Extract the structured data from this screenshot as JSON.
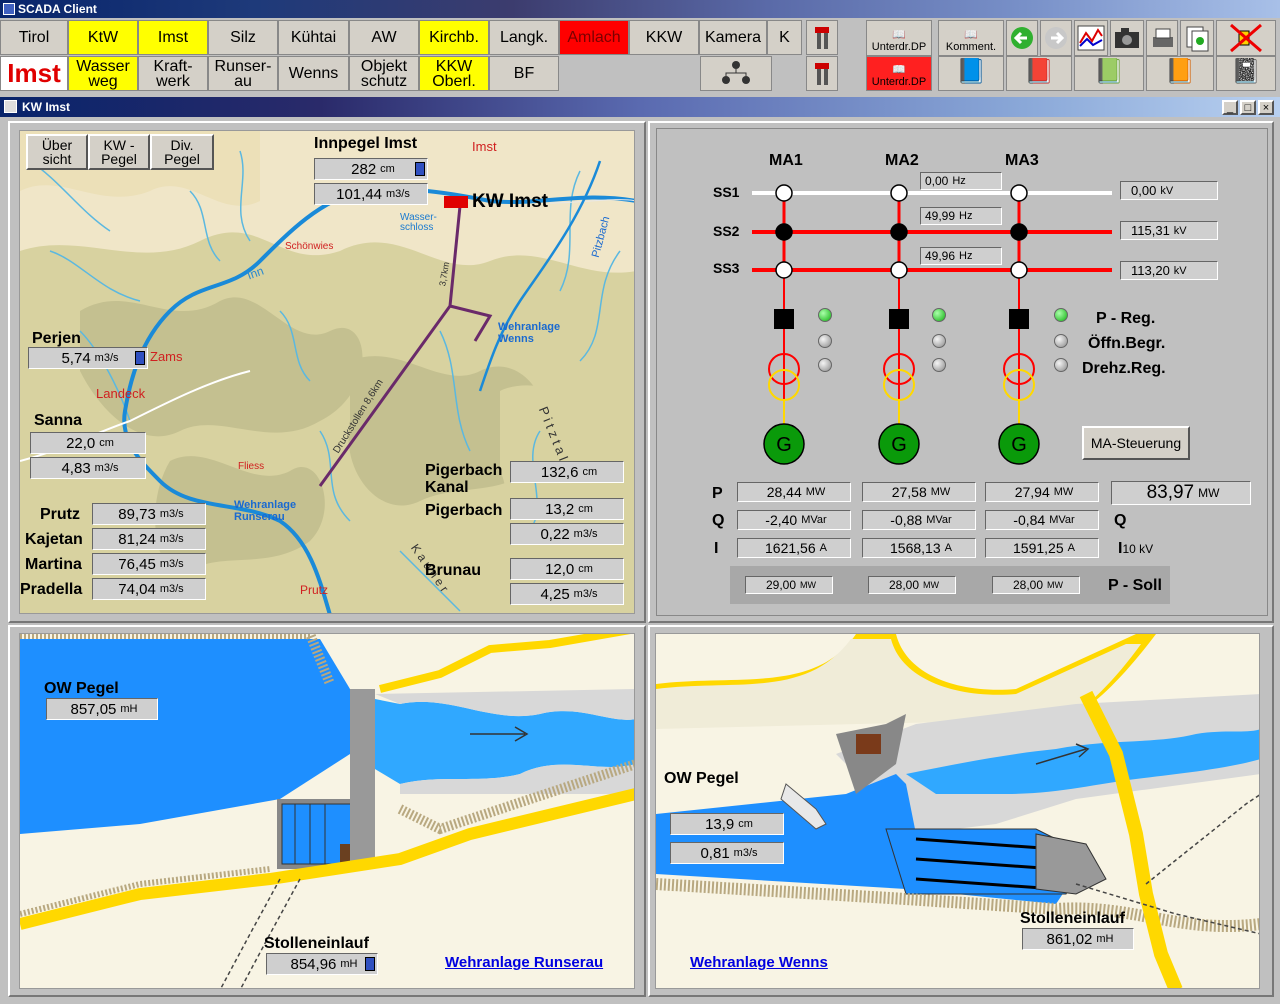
{
  "window_title": "SCADA Client",
  "nav_row1": [
    {
      "label": "Tirol",
      "style": "n"
    },
    {
      "label": "KtW",
      "style": "y"
    },
    {
      "label": "Imst",
      "style": "y"
    },
    {
      "label": "Silz",
      "style": "n"
    },
    {
      "label": "Kühtai",
      "style": "n"
    },
    {
      "label": "AW",
      "style": "n"
    },
    {
      "label": "Kirchb.",
      "style": "y"
    },
    {
      "label": "Langk.",
      "style": "n"
    },
    {
      "label": "Amlach",
      "style": "r"
    },
    {
      "label": "KKW",
      "style": "n"
    },
    {
      "label": "Kamera",
      "style": "n"
    },
    {
      "label": "K",
      "style": "n"
    }
  ],
  "nav_row2": [
    {
      "label": "Imst",
      "style": "big"
    },
    {
      "label": "Wasser weg",
      "style": "y"
    },
    {
      "label": "Kraft- werk",
      "style": "n"
    },
    {
      "label": "Runser- au",
      "style": "n"
    },
    {
      "label": "Wenns",
      "style": "n"
    },
    {
      "label": "Objekt schutz",
      "style": "n"
    },
    {
      "label": "KKW Oberl.",
      "style": "y"
    },
    {
      "label": "BF",
      "style": "n"
    }
  ],
  "toolbar": {
    "unterdr_label": "Unterdr.DP",
    "komment_label": "Komment.",
    "unterdr2_label": "Unterdr.DP"
  },
  "subwindow": {
    "title": "KW Imst",
    "controls": [
      "_",
      "□",
      "×"
    ]
  },
  "map": {
    "tabs": [
      "Über sicht",
      "KW - Pegel",
      "Div. Pegel"
    ],
    "kw_label": "KW Imst",
    "inn_pegel": {
      "label": "Innpegel Imst",
      "level": "282",
      "level_unit": "cm",
      "flow": "101,44",
      "flow_unit": "m3/s"
    },
    "perjen": {
      "label": "Perjen",
      "flow": "5,74",
      "flow_unit": "m3/s"
    },
    "sanna": {
      "label": "Sanna",
      "level": "22,0",
      "level_unit": "cm",
      "flow": "4,83",
      "flow_unit": "m3/s"
    },
    "gauges": [
      {
        "label": "Prutz",
        "value": "89,73",
        "unit": "m3/s"
      },
      {
        "label": "Kajetan",
        "value": "81,24",
        "unit": "m3/s"
      },
      {
        "label": "Martina",
        "value": "76,45",
        "unit": "m3/s"
      },
      {
        "label": "Pradella",
        "value": "74,04",
        "unit": "m3/s"
      }
    ],
    "pigerbach_kanal": {
      "label": "Pigerbach Kanal",
      "value": "132,6",
      "unit": "cm"
    },
    "pigerbach": {
      "label": "Pigerbach",
      "level": "13,2",
      "level_unit": "cm",
      "flow": "0,22",
      "flow_unit": "m3/s"
    },
    "brunau": {
      "label": "Brunau",
      "level": "12,0",
      "level_unit": "cm",
      "flow": "4,25",
      "flow_unit": "m3/s"
    },
    "places": {
      "imst": "Imst",
      "schoenwies": "Schönwies",
      "inn": "Inn",
      "zams": "Zams",
      "landeck": "Landeck",
      "fliess": "Fliess",
      "prutz": "Prutz",
      "wasserschloss": "Wasser- schloss",
      "wehr_wenns": "Wehranlage Wenns",
      "wehr_runserau": "Wehranlage Runserau",
      "pitzbach": "Pitzbach",
      "druckstollen": "Druckstollen 8,6km",
      "dist": "3,7km",
      "pitztal": "P i t z t a l",
      "kaunertal": "K a u n e r"
    }
  },
  "electrical": {
    "machines": [
      "MA1",
      "MA2",
      "MA3"
    ],
    "busbars": [
      {
        "label": "SS1",
        "hz": "0,00",
        "hz_unit": "Hz",
        "kv": "0,00",
        "kv_unit": "kV",
        "color": "#ffffff"
      },
      {
        "label": "SS2",
        "hz": "49,99",
        "hz_unit": "Hz",
        "kv": "115,31",
        "kv_unit": "kV",
        "color": "#ff0000"
      },
      {
        "label": "SS3",
        "hz": "49,96",
        "hz_unit": "Hz",
        "kv": "113,20",
        "kv_unit": "kV",
        "color": "#ff0000"
      }
    ],
    "status_labels": [
      "P - Reg.",
      "Öffn.Begr.",
      "Drehz.Reg."
    ],
    "gen_label": "G",
    "ma_button": "MA-Steuerung",
    "row_labels": {
      "p": "P",
      "q": "Q",
      "i": "I",
      "q_right": "Q",
      "i_right": "I",
      "i_right_sub": "10 kV",
      "p_soll": "P - Soll"
    },
    "p": [
      {
        "v": "28,44",
        "u": "MW"
      },
      {
        "v": "27,58",
        "u": "MW"
      },
      {
        "v": "27,94",
        "u": "MW"
      }
    ],
    "p_total": {
      "v": "83,97",
      "u": "MW"
    },
    "q": [
      {
        "v": "-2,40",
        "u": "MVar"
      },
      {
        "v": "-0,88",
        "u": "MVar"
      },
      {
        "v": "-0,84",
        "u": "MVar"
      }
    ],
    "i": [
      {
        "v": "1621,56",
        "u": "A"
      },
      {
        "v": "1568,13",
        "u": "A"
      },
      {
        "v": "1591,25",
        "u": "A"
      }
    ],
    "p_soll": [
      {
        "v": "29,00",
        "u": "MW"
      },
      {
        "v": "28,00",
        "u": "MW"
      },
      {
        "v": "28,00",
        "u": "MW"
      }
    ]
  },
  "runserau": {
    "ow_label": "OW Pegel",
    "ow": "857,05",
    "ow_unit": "mH",
    "stollen_label": "Stolleneinlauf",
    "stollen": "854,96",
    "stollen_unit": "mH",
    "link": "Wehranlage Runserau"
  },
  "wenns": {
    "ow_label": "OW Pegel",
    "ow_level": "13,9",
    "ow_level_unit": "cm",
    "ow_flow": "0,81",
    "ow_flow_unit": "m3/s",
    "stollen_label": "Stolleneinlauf",
    "stollen": "861,02",
    "stollen_unit": "mH",
    "link": "Wehranlage Wenns"
  }
}
